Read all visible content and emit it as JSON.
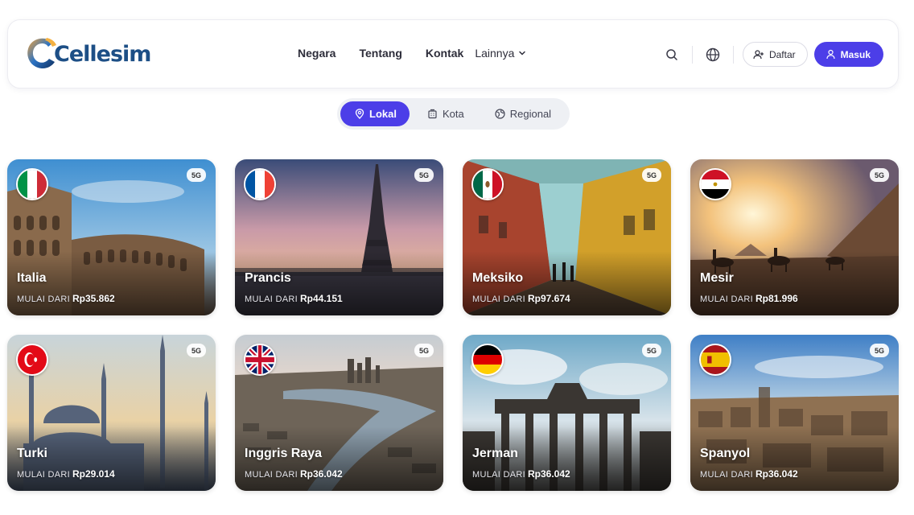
{
  "brand": {
    "name": "Cellesim"
  },
  "nav": {
    "links": [
      "Negara",
      "Tentang",
      "Kontak"
    ],
    "more_label": "Lainnya",
    "register_label": "Daftar",
    "login_label": "Masuk"
  },
  "tabs": [
    {
      "label": "Lokal",
      "icon": "map-pin-icon",
      "active": true
    },
    {
      "label": "Kota",
      "icon": "building-icon",
      "active": false
    },
    {
      "label": "Regional",
      "icon": "globe-region-icon",
      "active": false
    }
  ],
  "price_prefix": "MULAI DARI",
  "cards": [
    {
      "country": "Italia",
      "price": "Rp35.862",
      "network": "5G",
      "flag": "flag-italy-icon"
    },
    {
      "country": "Prancis",
      "price": "Rp44.151",
      "network": "5G",
      "flag": "flag-france-icon"
    },
    {
      "country": "Meksiko",
      "price": "Rp97.674",
      "network": "5G",
      "flag": "flag-mexico-icon"
    },
    {
      "country": "Mesir",
      "price": "Rp81.996",
      "network": "5G",
      "flag": "flag-egypt-icon"
    },
    {
      "country": "Turki",
      "price": "Rp29.014",
      "network": "5G",
      "flag": "flag-turkey-icon"
    },
    {
      "country": "Inggris Raya",
      "price": "Rp36.042",
      "network": "5G",
      "flag": "flag-uk-icon"
    },
    {
      "country": "Jerman",
      "price": "Rp36.042",
      "network": "5G",
      "flag": "flag-germany-icon"
    },
    {
      "country": "Spanyol",
      "price": "Rp36.042",
      "network": "5G",
      "flag": "flag-spain-icon"
    }
  ],
  "colors": {
    "accent": "#4c3ee8",
    "brand_blue": "#1d4f86"
  }
}
